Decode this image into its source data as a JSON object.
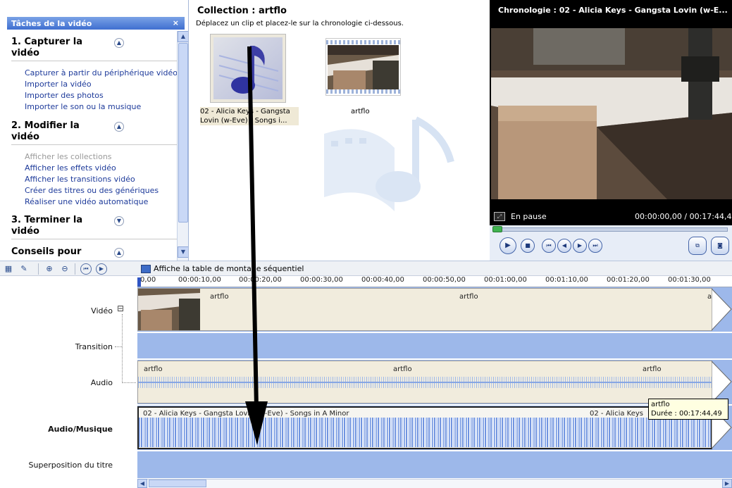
{
  "taskpane": {
    "header": "Tâches de la vidéo",
    "close": "×",
    "sections": [
      {
        "title": "1. Capturer la vidéo",
        "links": [
          "Capturer à partir du périphérique vidéo",
          "Importer la vidéo",
          "Importer des photos",
          "Importer le son ou la musique"
        ]
      },
      {
        "title": "2. Modifier la vidéo",
        "links": [
          "Afficher les collections",
          "Afficher les effets vidéo",
          "Afficher les transitions vidéo",
          "Créer des titres ou des génériques",
          "Réaliser une vidéo automatique"
        ]
      },
      {
        "title": "3. Terminer la vidéo"
      },
      {
        "title": "Conseils pour"
      }
    ]
  },
  "collection": {
    "title": "Collection : artflo",
    "description": "Déplacez un clip et placez-le sur la chronologie ci-dessous.",
    "items": [
      {
        "label": "02 - Alicia Keys - Gangsta Lovin (w-Eve) - Songs i..."
      },
      {
        "label": "artflo"
      }
    ]
  },
  "preview": {
    "title": "Chronologie : 02 - Alicia Keys - Gangsta Lovin (w-E...",
    "status": "En pause",
    "time": "00:00:00,00 / 00:17:44,48"
  },
  "toolbar": {
    "storyboard_label": "Affiche la table de montage séquentiel"
  },
  "timeline": {
    "ruler": [
      "0,00",
      "00:00:10,00",
      "00:00:20,00",
      "00:00:30,00",
      "00:00:40,00",
      "00:00:50,00",
      "00:01:00,00",
      "00:01:10,00",
      "00:01:20,00",
      "00:01:30,00"
    ],
    "tracks": {
      "video": "Vidéo",
      "transition": "Transition",
      "audio": "Audio",
      "music": "Audio/Musique",
      "title_overlay": "Superposition du titre"
    },
    "video_expand": "⊟",
    "video_clips": [
      "artflo",
      "artflo",
      "a"
    ],
    "audio_clips": [
      "artflo",
      "artflo",
      "artflo"
    ],
    "music_clips": [
      "02 - Alicia Keys - Gangsta Lovin (w-Eve) - Songs in A Minor",
      "02 - Alicia Keys"
    ]
  },
  "tooltip": {
    "line1": "artflo",
    "line2": "Durée : 00:17:44,49"
  },
  "colors": {
    "track_blue": "#9db8ea",
    "clip_beige": "#f1ecdd",
    "arrow": "#000000"
  }
}
